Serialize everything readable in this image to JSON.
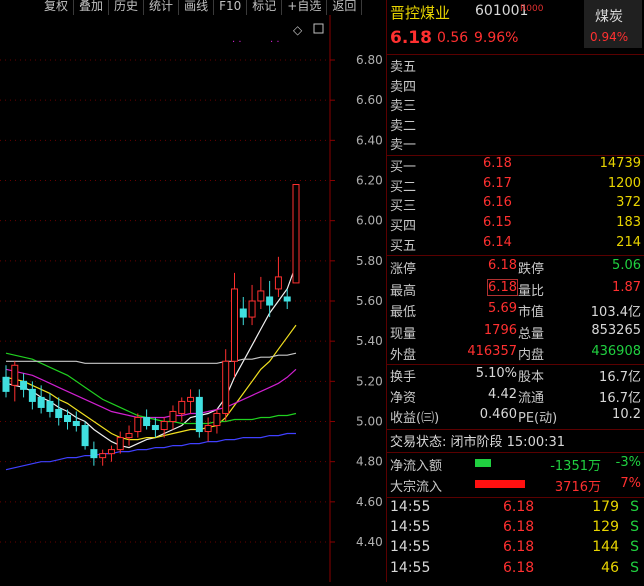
{
  "toolbar": [
    "复权",
    "叠加",
    "历史",
    "统计",
    "画线",
    "F10",
    "标记",
    "+自选",
    "返回"
  ],
  "chart": {
    "yaxis": [
      "6.80",
      "6.60",
      "6.40",
      "6.20",
      "6.00",
      "5.80",
      "5.60",
      "5.40",
      "5.20",
      "5.00",
      "4.80",
      "4.60",
      "4.40"
    ],
    "ymin": 4.4,
    "ymax": 6.8,
    "candles": [
      {
        "o": 5.22,
        "h": 5.28,
        "l": 5.12,
        "c": 5.15
      },
      {
        "o": 5.18,
        "h": 5.3,
        "l": 5.1,
        "c": 5.28
      },
      {
        "o": 5.2,
        "h": 5.24,
        "l": 5.12,
        "c": 5.16
      },
      {
        "o": 5.16,
        "h": 5.2,
        "l": 5.06,
        "c": 5.1
      },
      {
        "o": 5.12,
        "h": 5.18,
        "l": 5.04,
        "c": 5.07
      },
      {
        "o": 5.1,
        "h": 5.14,
        "l": 5.02,
        "c": 5.05
      },
      {
        "o": 5.06,
        "h": 5.12,
        "l": 4.98,
        "c": 5.02
      },
      {
        "o": 5.03,
        "h": 5.06,
        "l": 4.96,
        "c": 5.0
      },
      {
        "o": 5.0,
        "h": 5.05,
        "l": 4.95,
        "c": 4.98
      },
      {
        "o": 4.98,
        "h": 5.0,
        "l": 4.86,
        "c": 4.88
      },
      {
        "o": 4.86,
        "h": 4.9,
        "l": 4.78,
        "c": 4.82
      },
      {
        "o": 4.82,
        "h": 4.86,
        "l": 4.78,
        "c": 4.84
      },
      {
        "o": 4.84,
        "h": 4.88,
        "l": 4.8,
        "c": 4.86
      },
      {
        "o": 4.86,
        "h": 4.95,
        "l": 4.84,
        "c": 4.92
      },
      {
        "o": 4.92,
        "h": 4.98,
        "l": 4.88,
        "c": 4.94
      },
      {
        "o": 4.95,
        "h": 5.04,
        "l": 4.92,
        "c": 5.02
      },
      {
        "o": 5.02,
        "h": 5.06,
        "l": 4.96,
        "c": 4.98
      },
      {
        "o": 4.98,
        "h": 5.02,
        "l": 4.92,
        "c": 4.96
      },
      {
        "o": 4.96,
        "h": 5.02,
        "l": 4.92,
        "c": 5.0
      },
      {
        "o": 5.0,
        "h": 5.08,
        "l": 4.96,
        "c": 5.05
      },
      {
        "o": 5.04,
        "h": 5.12,
        "l": 5.0,
        "c": 5.1
      },
      {
        "o": 5.1,
        "h": 5.16,
        "l": 5.04,
        "c": 5.12
      },
      {
        "o": 5.12,
        "h": 5.16,
        "l": 4.92,
        "c": 4.95
      },
      {
        "o": 4.95,
        "h": 5.02,
        "l": 4.9,
        "c": 4.98
      },
      {
        "o": 4.98,
        "h": 5.06,
        "l": 4.94,
        "c": 5.04
      },
      {
        "o": 5.04,
        "h": 5.36,
        "l": 5.0,
        "c": 5.3
      },
      {
        "o": 5.3,
        "h": 5.74,
        "l": 5.22,
        "c": 5.66
      },
      {
        "o": 5.56,
        "h": 5.62,
        "l": 5.48,
        "c": 5.52
      },
      {
        "o": 5.52,
        "h": 5.68,
        "l": 5.48,
        "c": 5.6
      },
      {
        "o": 5.6,
        "h": 5.72,
        "l": 5.56,
        "c": 5.65
      },
      {
        "o": 5.62,
        "h": 5.7,
        "l": 5.52,
        "c": 5.58
      },
      {
        "o": 5.66,
        "h": 5.82,
        "l": 5.62,
        "c": 5.72
      },
      {
        "o": 5.62,
        "h": 5.66,
        "l": 5.56,
        "c": 5.6
      },
      {
        "o": 5.69,
        "h": 6.18,
        "l": 5.69,
        "c": 6.18
      }
    ],
    "ma": [
      {
        "color": "#f0f0f0",
        "pts": [
          5.19,
          5.18,
          5.17,
          5.15,
          5.12,
          5.1,
          5.07,
          5.05,
          5.02,
          5.0,
          4.96,
          4.93,
          4.9,
          4.88,
          4.87,
          4.89,
          4.91,
          4.92,
          4.94,
          4.96,
          4.98,
          5.02,
          5.03,
          5.04,
          5.06,
          5.12,
          5.22,
          5.3,
          5.38,
          5.46,
          5.54,
          5.6,
          5.66,
          5.78
        ]
      },
      {
        "color": "#f0e020",
        "pts": [
          5.22,
          5.21,
          5.2,
          5.18,
          5.16,
          5.14,
          5.11,
          5.09,
          5.06,
          5.03,
          5.0,
          4.97,
          4.94,
          4.92,
          4.91,
          4.91,
          4.92,
          4.92,
          4.93,
          4.94,
          4.95,
          4.96,
          4.96,
          4.97,
          4.98,
          5.02,
          5.08,
          5.14,
          5.2,
          5.26,
          5.3,
          5.36,
          5.42,
          5.48
        ]
      },
      {
        "color": "#d020d0",
        "pts": [
          5.26,
          5.25,
          5.24,
          5.23,
          5.21,
          5.19,
          5.17,
          5.15,
          5.13,
          5.11,
          5.09,
          5.07,
          5.05,
          5.04,
          5.03,
          5.02,
          5.02,
          5.02,
          5.02,
          5.03,
          5.03,
          5.04,
          5.04,
          5.05,
          5.06,
          5.07,
          5.09,
          5.11,
          5.13,
          5.15,
          5.17,
          5.19,
          5.22,
          5.26
        ]
      },
      {
        "color": "#20d020",
        "pts": [
          5.34,
          5.33,
          5.32,
          5.31,
          5.29,
          5.27,
          5.25,
          5.23,
          5.2,
          5.17,
          5.14,
          5.11,
          5.09,
          5.07,
          5.05,
          5.03,
          5.02,
          5.01,
          5.0,
          5.0,
          4.99,
          4.99,
          4.99,
          4.99,
          5.0,
          5.0,
          5.01,
          5.01,
          5.01,
          5.02,
          5.02,
          5.03,
          5.03,
          5.04
        ]
      },
      {
        "color": "#c8c8c8",
        "pts": [
          5.3,
          5.3,
          5.3,
          5.3,
          5.3,
          5.3,
          5.3,
          5.3,
          5.3,
          5.29,
          5.29,
          5.29,
          5.29,
          5.29,
          5.29,
          5.29,
          5.29,
          5.29,
          5.29,
          5.29,
          5.29,
          5.29,
          5.29,
          5.29,
          5.29,
          5.3,
          5.3,
          5.31,
          5.31,
          5.32,
          5.32,
          5.33,
          5.33,
          5.34
        ]
      },
      {
        "color": "#4040ff",
        "pts": [
          4.76,
          4.77,
          4.78,
          4.79,
          4.8,
          4.8,
          4.81,
          4.82,
          4.82,
          4.83,
          4.83,
          4.84,
          4.84,
          4.85,
          4.85,
          4.86,
          4.86,
          4.87,
          4.87,
          4.88,
          4.88,
          4.89,
          4.89,
          4.9,
          4.9,
          4.91,
          4.91,
          4.92,
          4.92,
          4.92,
          4.93,
          4.93,
          4.94,
          4.94
        ]
      }
    ]
  },
  "stock": {
    "name": "晋控煤业",
    "code": "601001",
    "tag": "R000",
    "price": "6.18",
    "change": "0.56",
    "pct": "9.96%",
    "sector": "煤炭",
    "sector_pct": "0.94%"
  },
  "asks": [
    "卖五",
    "卖四",
    "卖三",
    "卖二",
    "卖一"
  ],
  "bids": [
    {
      "label": "买一",
      "price": "6.18",
      "vol": "14739"
    },
    {
      "label": "买二",
      "price": "6.17",
      "vol": "1200"
    },
    {
      "label": "买三",
      "price": "6.16",
      "vol": "372"
    },
    {
      "label": "买四",
      "price": "6.15",
      "vol": "183"
    },
    {
      "label": "买五",
      "price": "6.14",
      "vol": "214"
    }
  ],
  "quote": [
    {
      "l1": "涨停",
      "v1": "6.18",
      "c1": "red",
      "l2": "跌停",
      "v2": "5.06",
      "c2": "green"
    },
    {
      "l1": "最高",
      "v1": "6.18",
      "c1": "red",
      "l2": "量比",
      "v2": "1.87",
      "c2": "red",
      "box": true
    },
    {
      "l1": "最低",
      "v1": "5.69",
      "c1": "red",
      "l2": "市值",
      "v2": "103.4亿",
      "c2": "white"
    },
    {
      "l1": "现量",
      "v1": "1796",
      "c1": "red",
      "l2": "总量",
      "v2": "853265",
      "c2": "white"
    },
    {
      "l1": "外盘",
      "v1": "416357",
      "c1": "red",
      "l2": "内盘",
      "v2": "436908",
      "c2": "green"
    }
  ],
  "stats": [
    {
      "l1": "换手",
      "v1": "5.10%",
      "l2": "股本",
      "v2": "16.7亿"
    },
    {
      "l1": "净资",
      "v1": "4.42",
      "l2": "流通",
      "v2": "16.7亿"
    },
    {
      "l1": "收益(㈢)",
      "v1": "0.460",
      "l2": "PE(动)",
      "v2": "10.2"
    }
  ],
  "status": "交易状态: 闭市阶段 15:00:31",
  "flows": [
    {
      "label": "净流入额",
      "color": "#20d040",
      "value": "-1351万",
      "pct": "-3%",
      "vc": "green"
    },
    {
      "label": "大宗流入",
      "color": "#ff1010",
      "value": "3716万",
      "pct": "7%",
      "vc": "red"
    }
  ],
  "ticks": [
    {
      "time": "14:55",
      "price": "6.18",
      "vol": "179",
      "side": "S"
    },
    {
      "time": "14:55",
      "price": "6.18",
      "vol": "129",
      "side": "S"
    },
    {
      "time": "14:55",
      "price": "6.18",
      "vol": "144",
      "side": "S"
    },
    {
      "time": "14:55",
      "price": "6.18",
      "vol": "46",
      "side": "S"
    }
  ]
}
